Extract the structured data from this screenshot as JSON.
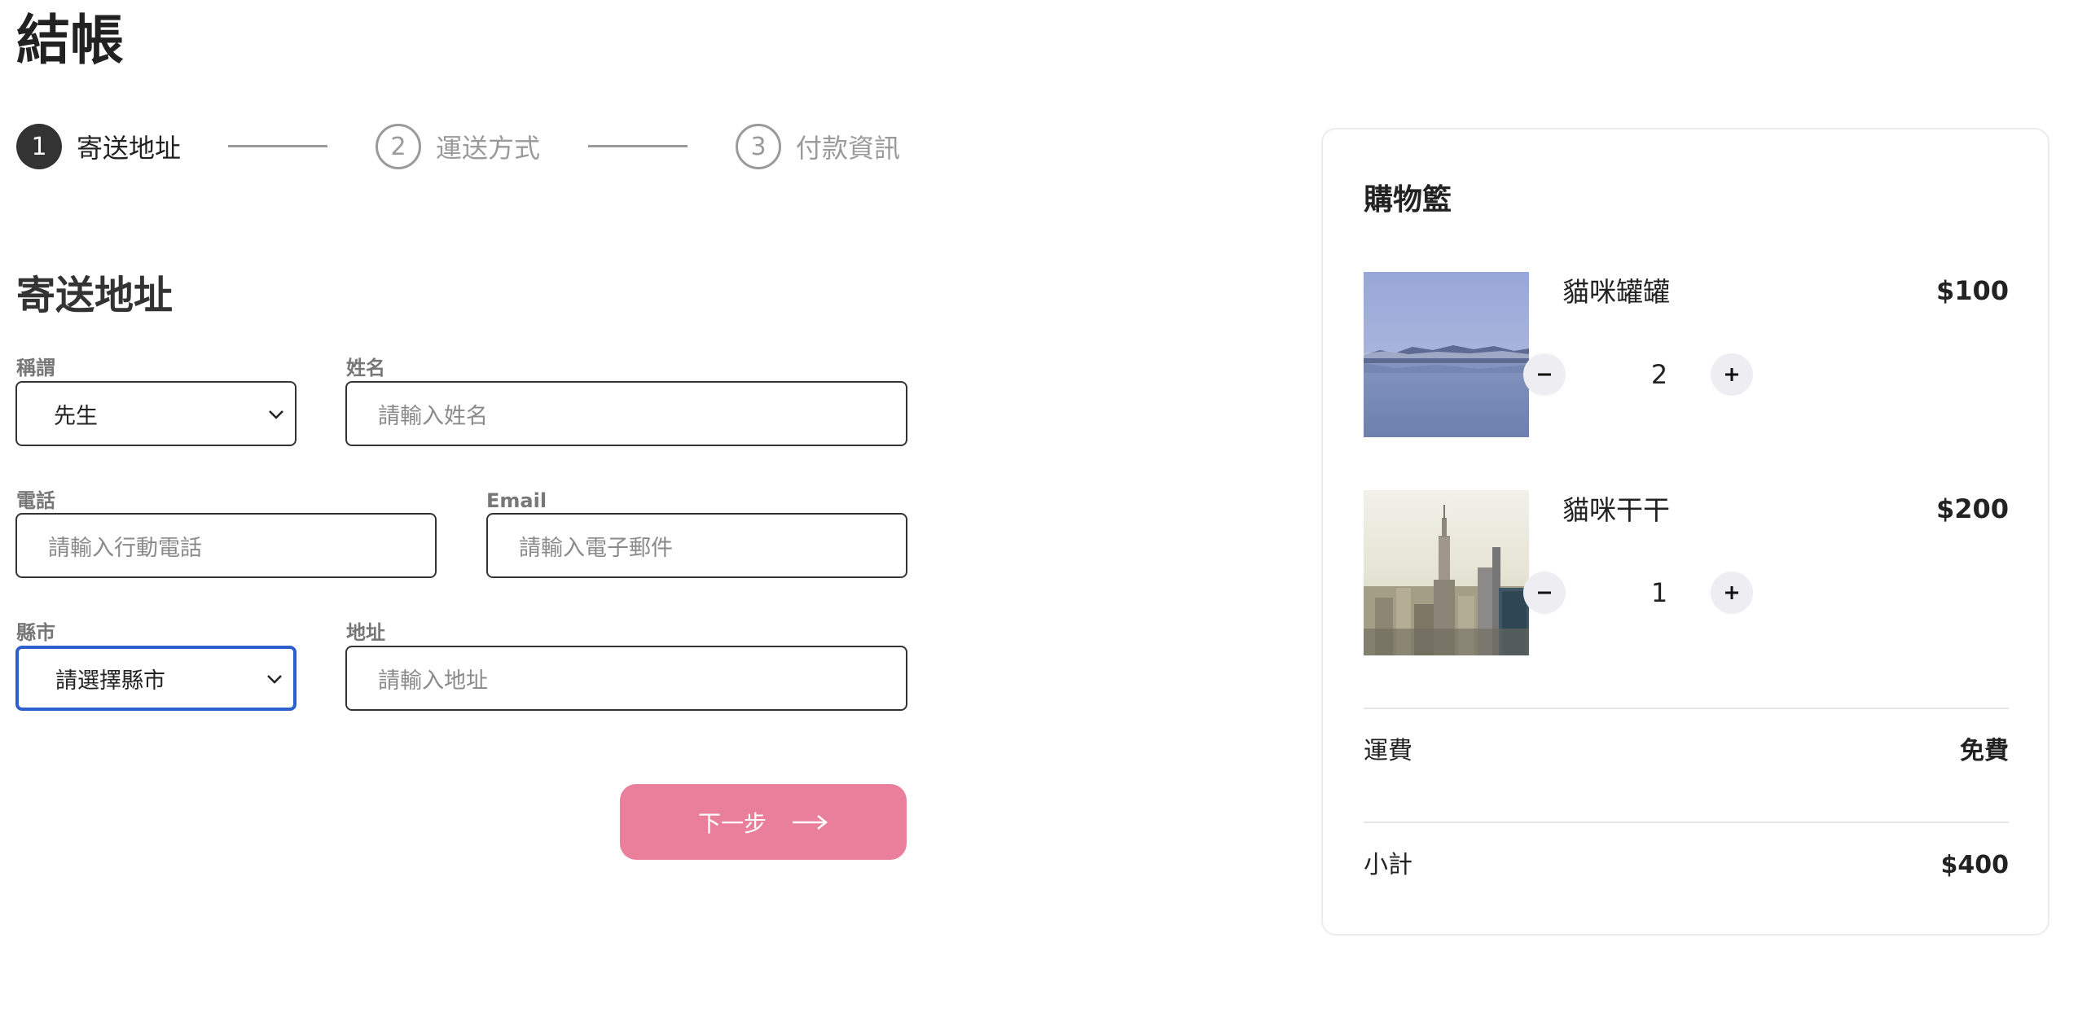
{
  "page": {
    "title": "結帳"
  },
  "stepper": {
    "steps": [
      {
        "number": "1",
        "label": "寄送地址",
        "state": "active"
      },
      {
        "number": "2",
        "label": "運送方式",
        "state": "inactive"
      },
      {
        "number": "3",
        "label": "付款資訊",
        "state": "inactive"
      }
    ]
  },
  "form": {
    "section_title": "寄送地址",
    "salutation": {
      "label": "稱謂",
      "value": "先生"
    },
    "name": {
      "label": "姓名",
      "placeholder": "請輸入姓名"
    },
    "phone": {
      "label": "電話",
      "placeholder": "請輸入行動電話"
    },
    "email": {
      "label": "Email",
      "placeholder": "請輸入電子郵件"
    },
    "city": {
      "label": "縣市",
      "value": "請選擇縣市"
    },
    "address": {
      "label": "地址",
      "placeholder": "請輸入地址"
    },
    "next_label": "下一步"
  },
  "cart": {
    "title": "購物籃",
    "items": [
      {
        "name": "貓咪罐罐",
        "price": "$100",
        "quantity": "2"
      },
      {
        "name": "貓咪干干",
        "price": "$200",
        "quantity": "1"
      }
    ],
    "shipping": {
      "label": "運費",
      "value": "免費"
    },
    "subtotal": {
      "label": "小計",
      "value": "$400"
    }
  },
  "colors": {
    "accent_button": "#e97f9b",
    "focus_border": "#2e5fd0",
    "active_step": "#333333"
  }
}
